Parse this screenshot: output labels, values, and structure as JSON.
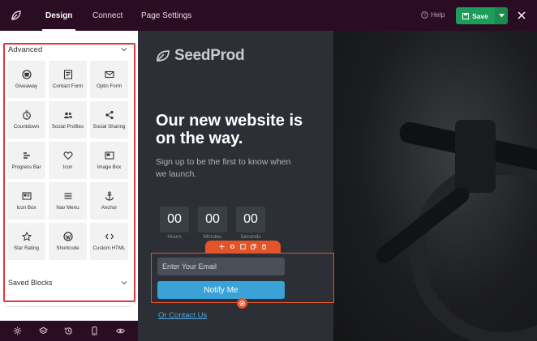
{
  "topbar": {
    "tabs": [
      {
        "label": "Design",
        "active": true
      },
      {
        "label": "Connect",
        "active": false
      },
      {
        "label": "Page Settings",
        "active": false
      }
    ],
    "help_label": "Help",
    "save_label": "Save"
  },
  "sidebar": {
    "advanced_title": "Advanced",
    "blocks": [
      {
        "label": "Giveaway",
        "icon": "giveaway-icon"
      },
      {
        "label": "Contact Form",
        "icon": "contact-form-icon"
      },
      {
        "label": "Optin Form",
        "icon": "optin-form-icon"
      },
      {
        "label": "Countdown",
        "icon": "countdown-icon"
      },
      {
        "label": "Social Profiles",
        "icon": "social-profiles-icon"
      },
      {
        "label": "Social Sharing",
        "icon": "social-sharing-icon"
      },
      {
        "label": "Progress Bar",
        "icon": "progress-bar-icon"
      },
      {
        "label": "Icon",
        "icon": "heart-icon"
      },
      {
        "label": "Image Box",
        "icon": "image-box-icon"
      },
      {
        "label": "Icon Box",
        "icon": "icon-box-icon"
      },
      {
        "label": "Nav Menu",
        "icon": "nav-menu-icon"
      },
      {
        "label": "Anchor",
        "icon": "anchor-icon"
      },
      {
        "label": "Star Rating",
        "icon": "star-icon"
      },
      {
        "label": "Shortcode",
        "icon": "wordpress-icon"
      },
      {
        "label": "Custom HTML",
        "icon": "code-icon"
      }
    ],
    "saved_blocks_title": "Saved Blocks"
  },
  "canvas": {
    "brand": "SeedProd",
    "headline": "Our new website is on the way.",
    "subline": "Sign up to be the first to know when we launch.",
    "countdown": [
      {
        "value": "00",
        "label": "Hours"
      },
      {
        "value": "00",
        "label": "Minutes"
      },
      {
        "value": "00",
        "label": "Seconds"
      }
    ],
    "email_placeholder": "Enter Your Email",
    "notify_label": "Notify Me",
    "contact_link": "Or Contact Us"
  },
  "colors": {
    "topbar_bg": "#2a0d22",
    "save_green": "#1e9c5a",
    "selection_orange": "#e2542a",
    "highlight_red": "#e3373b",
    "button_blue": "#3ba2d8"
  }
}
